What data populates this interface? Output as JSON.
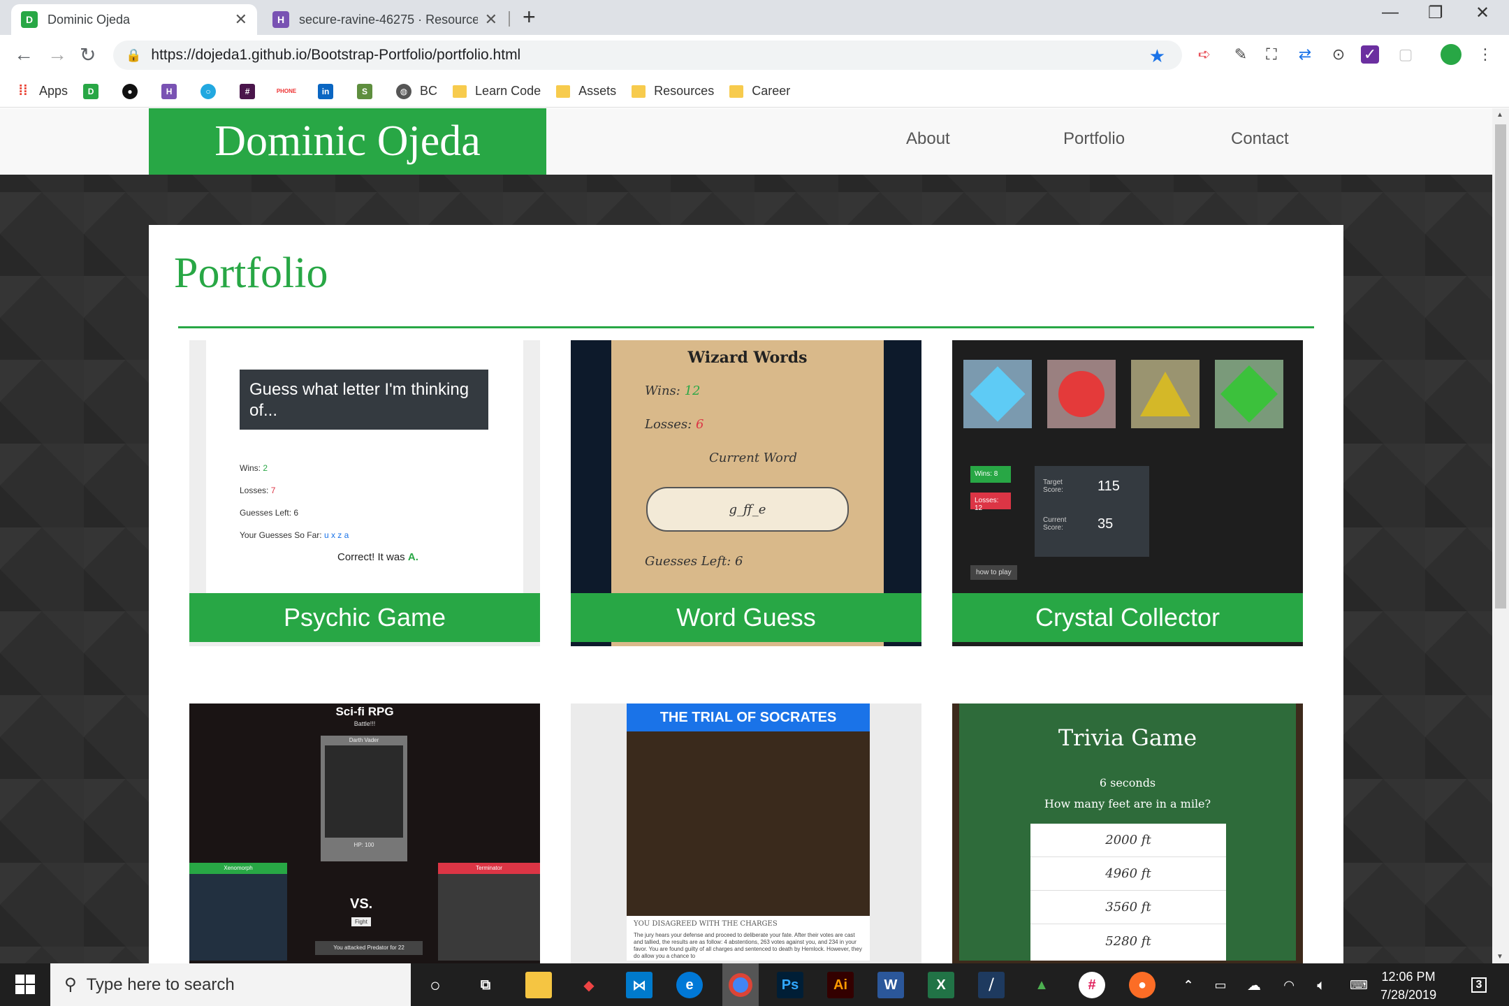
{
  "browser": {
    "tabs": [
      {
        "title": "Dominic Ojeda",
        "active": true
      },
      {
        "title": "secure-ravine-46275 · Resources",
        "active": false
      }
    ],
    "url": "https://dojeda1.github.io/Bootstrap-Portfolio/portfolio.html",
    "bookmarks": [
      {
        "label": "Apps",
        "icon": "apps-grid-icon"
      },
      {
        "label": "",
        "icon": "site-icon"
      },
      {
        "label": "",
        "icon": "github-icon"
      },
      {
        "label": "",
        "icon": "heroku-icon"
      },
      {
        "label": "",
        "icon": "circle-icon"
      },
      {
        "label": "",
        "icon": "slack-icon"
      },
      {
        "label": "",
        "icon": "phone-icon"
      },
      {
        "label": "",
        "icon": "linkedin-icon"
      },
      {
        "label": "",
        "icon": "shopify-icon"
      },
      {
        "label": "BC",
        "icon": "globe-icon"
      },
      {
        "label": "Learn Code",
        "icon": "folder-icon"
      },
      {
        "label": "Assets",
        "icon": "folder-icon"
      },
      {
        "label": "Resources",
        "icon": "folder-icon"
      },
      {
        "label": "Career",
        "icon": "folder-icon"
      }
    ]
  },
  "site": {
    "brand": "Dominic Ojeda",
    "nav": [
      "About",
      "Portfolio",
      "Contact"
    ],
    "heading": "Portfolio",
    "accent": "#28a745"
  },
  "thumbs": {
    "psychic": {
      "caption": "Psychic Game",
      "title": "Guess what letter I'm thinking of...",
      "wins_label": "Wins:",
      "wins": "2",
      "losses_label": "Losses:",
      "losses": "7",
      "left": "Guesses Left: 6",
      "sofar_label": "Your Guesses So Far:",
      "sofar": "u x z a",
      "correct": "Correct! It was",
      "correct_letter": "A."
    },
    "word": {
      "caption": "Word Guess",
      "title": "Wizard Words",
      "wins_label": "Wins:",
      "wins": "12",
      "losses_label": "Losses:",
      "losses": "6",
      "current": "Current Word",
      "word": "g_ff_e",
      "left": "Guesses Left: 6"
    },
    "crystal": {
      "caption": "Crystal Collector",
      "wins": "Wins: 8",
      "losses": "Losses: 12",
      "target_label": "Target Score:",
      "target": "115",
      "current_label": "Current Score:",
      "current": "35",
      "howto": "how to play"
    },
    "rpg": {
      "title": "Sci-fi RPG",
      "sub": "Battle!!!",
      "player": "Darth Vader",
      "hp": "HP: 100",
      "left": "Xenomorph",
      "right": "Terminator",
      "vs": "VS.",
      "fight": "Fight",
      "log": "You attacked Predator for 22"
    },
    "socrates": {
      "title": "THE TRIAL OF SOCRATES",
      "sub": "You disagreed with the charges",
      "body": "The jury hears your defense and proceed to deliberate your fate. After their votes are cast and tallied, the results are as follow: 4 abstentions, 263 votes against you, and 234 in your favor. You are found guilty of all charges and sentenced to death by Hemlock. However, they do allow you a chance to"
    },
    "trivia": {
      "title": "Trivia Game",
      "time": "6 seconds",
      "question": "How many feet are in a mile?",
      "answers": [
        "2000 ft",
        "4960 ft",
        "3560 ft",
        "5280 ft"
      ]
    }
  },
  "taskbar": {
    "search": "Type here to search",
    "time": "12:06 PM",
    "date": "7/28/2019",
    "notif": "3"
  }
}
